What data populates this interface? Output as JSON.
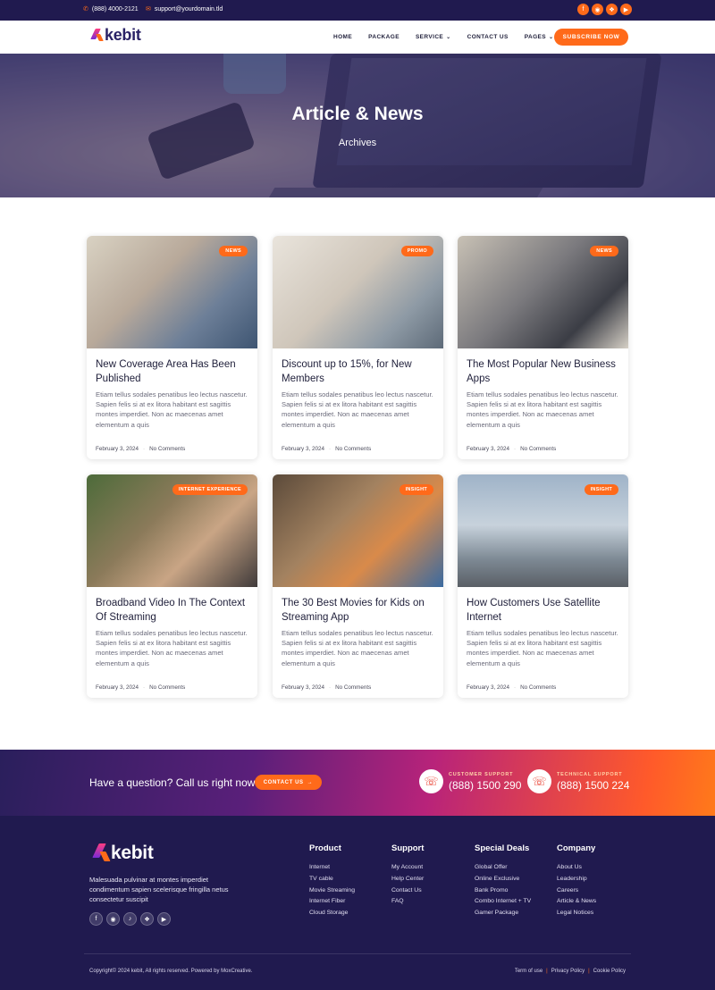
{
  "topbar": {
    "phone": "(888) 4000-2121",
    "email": "support@yourdomain.tld",
    "social": [
      "facebook-icon",
      "instagram-icon",
      "twitter-icon",
      "youtube-icon"
    ]
  },
  "nav": {
    "logo": "kebit",
    "items": [
      {
        "label": "HOME",
        "has_dropdown": false
      },
      {
        "label": "PACKAGE",
        "has_dropdown": false
      },
      {
        "label": "SERVICE",
        "has_dropdown": true
      },
      {
        "label": "CONTACT US",
        "has_dropdown": false
      },
      {
        "label": "PAGES",
        "has_dropdown": true
      }
    ],
    "cta": "SUBSCRIBE NOW"
  },
  "hero": {
    "title": "Article & News",
    "breadcrumb": "Archives"
  },
  "posts": [
    {
      "tag": "NEWS",
      "title": "New Coverage Area Has Been Published",
      "excerpt": "Etiam tellus sodales penatibus leo lectus nascetur. Sapien felis si at ex litora habitant est sagittis montes imperdiet. Non ac maecenas amet elementum a quis",
      "date": "February 3, 2024",
      "comments": "No Comments"
    },
    {
      "tag": "PROMO",
      "title": "Discount up to 15%, for New Members",
      "excerpt": "Etiam tellus sodales penatibus leo lectus nascetur. Sapien felis si at ex litora habitant est sagittis montes imperdiet. Non ac maecenas amet elementum a quis",
      "date": "February 3, 2024",
      "comments": "No Comments"
    },
    {
      "tag": "NEWS",
      "title": "The Most Popular New Business Apps",
      "excerpt": "Etiam tellus sodales penatibus leo lectus nascetur. Sapien felis si at ex litora habitant est sagittis montes imperdiet. Non ac maecenas amet elementum a quis",
      "date": "February 3, 2024",
      "comments": "No Comments"
    },
    {
      "tag": "INTERNET EXPERIENCE",
      "title": "Broadband Video In The Context Of Streaming",
      "excerpt": "Etiam tellus sodales penatibus leo lectus nascetur. Sapien felis si at ex litora habitant est sagittis montes imperdiet. Non ac maecenas amet elementum a quis",
      "date": "February 3, 2024",
      "comments": "No Comments"
    },
    {
      "tag": "INSIGHT",
      "title": "The 30 Best Movies for Kids on Streaming App",
      "excerpt": "Etiam tellus sodales penatibus leo lectus nascetur. Sapien felis si at ex litora habitant est sagittis montes imperdiet. Non ac maecenas amet elementum a quis",
      "date": "February 3, 2024",
      "comments": "No Comments"
    },
    {
      "tag": "INSIGHT",
      "title": "How Customers Use Satellite Internet",
      "excerpt": "Etiam tellus sodales penatibus leo lectus nascetur. Sapien felis si at ex litora habitant est sagittis montes imperdiet. Non ac maecenas amet elementum a quis",
      "date": "February 3, 2024",
      "comments": "No Comments"
    }
  ],
  "cta_band": {
    "question": "Have a question? Call us right now",
    "button": "CONTACT US",
    "supports": [
      {
        "label": "CUSTOMER SUPPORT",
        "number": "(888) 1500 290"
      },
      {
        "label": "TECHNICAL SUPPORT",
        "number": "(888) 1500 224"
      }
    ]
  },
  "footer": {
    "logo": "kebit",
    "description": "Malesuada pulvinar at montes imperdiet condimentum sapien scelerisque fringilla netus consectetur suscipit",
    "social": [
      "facebook-icon",
      "instagram-icon",
      "tiktok-icon",
      "twitter-icon",
      "youtube-icon"
    ],
    "columns": [
      {
        "heading": "Product",
        "links": [
          "Internet",
          "TV cable",
          "Movie Streaming",
          "Internet Fiber",
          "Cloud Storage"
        ]
      },
      {
        "heading": "Support",
        "links": [
          "My Account",
          "Help Center",
          "Contact Us",
          "FAQ"
        ]
      },
      {
        "heading": "Special Deals",
        "links": [
          "Global Offer",
          "Online Exclusive",
          "Bank Promo",
          "Combo Internet + TV",
          "Gamer Package"
        ]
      },
      {
        "heading": "Company",
        "links": [
          "About Us",
          "Leadership",
          "Careers",
          "Article & News",
          "Legal Notices"
        ]
      }
    ],
    "copyright": "Copyright© 2024 kebit, All rights reserved. Powered by MoxCreative.",
    "legal": [
      "Term of use",
      "Privacy Policy",
      "Cookie Policy"
    ]
  },
  "colors": {
    "accent": "#ff6a1a",
    "navy": "#201a4f"
  }
}
